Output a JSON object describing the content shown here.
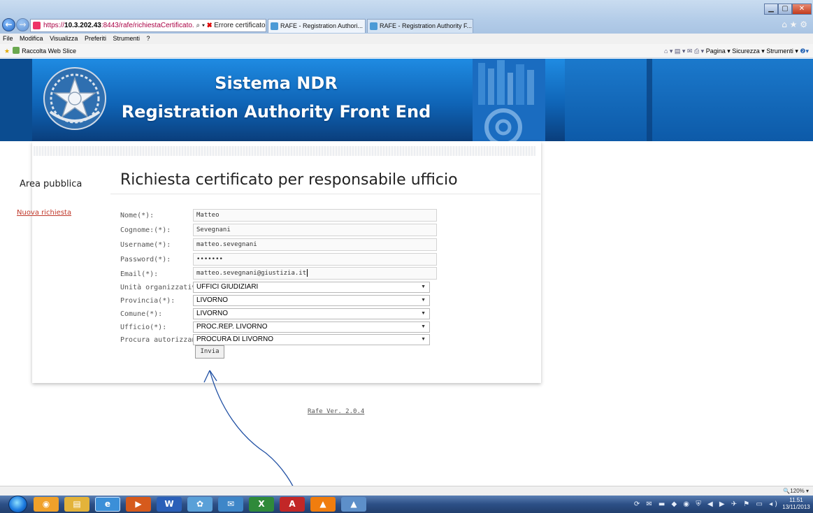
{
  "browser": {
    "address_url_prefix": "https://",
    "address_host": "10.3.202.43",
    "address_url_rest": ":8443/rafe/richiestaCertificato.",
    "address_search_glyph": "⌕ ▾",
    "cert_error": "Errore certificato",
    "refresh_stop": "C ✕",
    "tabs": [
      {
        "label": "RAFE - Registration Authori...",
        "close": "✕"
      },
      {
        "label": "RAFE - Registration Authority F..."
      }
    ],
    "menu": [
      "File",
      "Modifica",
      "Visualizza",
      "Preferiti",
      "Strumenti",
      "?"
    ],
    "favorites_item": "Raccolta Web Slice",
    "command_bar": {
      "home_icons": "⌂ ▾ ▤ ▾ ✉ ⎙ ▾",
      "page": "Pagina ▾",
      "safety": "Sicurezza ▾",
      "tools": "Strumenti ▾",
      "help": "❷▾"
    },
    "window_controls": {
      "minimize": "▁",
      "maximize": "▢",
      "close": "✕"
    },
    "top_right_icons": "⌂ ★ ⚙"
  },
  "header": {
    "title": "Sistema NDR",
    "subtitle": "Registration Authority Front End"
  },
  "sidebar": {
    "title": "Area pubblica",
    "link": "Nuova richiesta"
  },
  "form": {
    "title": "Richiesta certificato per responsabile ufficio",
    "fields": [
      {
        "label": "Nome(*):",
        "value": "Matteo"
      },
      {
        "label": "Cognome:(*):",
        "value": "Sevegnani"
      },
      {
        "label": "Username(*):",
        "value": "matteo.sevegnani"
      },
      {
        "label": "Password(*):",
        "value": "•••••••"
      },
      {
        "label": "Email(*):",
        "value": "matteo.sevegnani@giustizia.it"
      }
    ],
    "selects": [
      {
        "label": "Unità organizzativa(*):",
        "value": "UFFICI GIUDIZIARI"
      },
      {
        "label": "Provincia(*):",
        "value": "LIVORNO"
      },
      {
        "label": "Comune(*):",
        "value": "LIVORNO"
      },
      {
        "label": "Ufficio(*):",
        "value": "PROC.REP. LIVORNO"
      },
      {
        "label": "Procura autorizzante(*):",
        "value": "PROCURA DI LIVORNO"
      }
    ],
    "submit_label": "Invia"
  },
  "footer": {
    "version": "Rafe Ver. 2.0.4"
  },
  "statusbar": {
    "zoom": "🔍120%  ▾"
  },
  "taskbar": {
    "time": "11.51",
    "date": "13/11/2013",
    "tray_icons": "⟳ ✉ ▬ ◆ ◉ ⛨ ◀ ▶ ✈ ⚑ ▭ ◂)"
  },
  "colors": {
    "banner_blue": "#0f64b6",
    "link_red": "#c0392b",
    "annotation_blue": "#1f4fa3"
  }
}
